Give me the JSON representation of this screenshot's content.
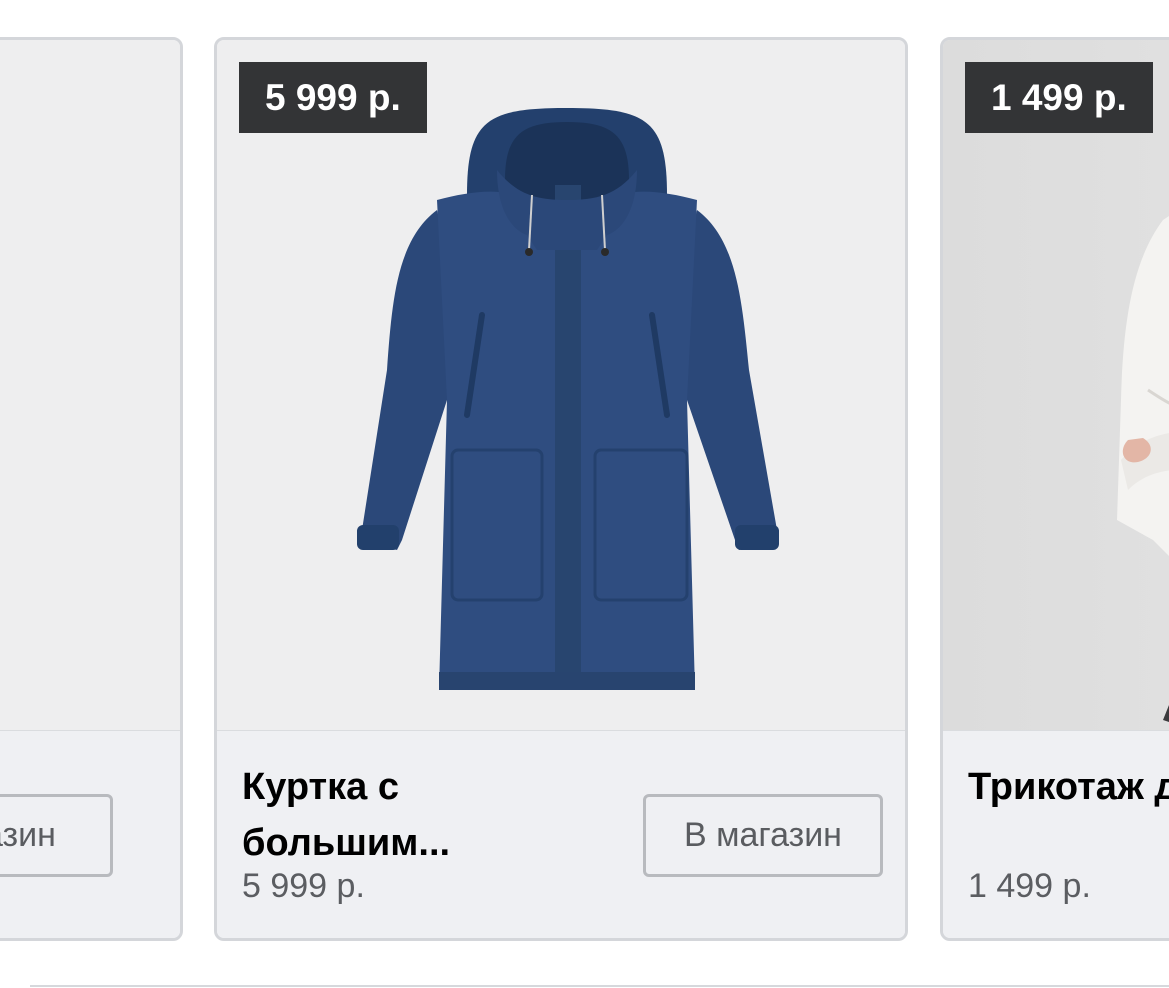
{
  "products": [
    {
      "title": "",
      "price_badge": "",
      "price": "",
      "button_label": "магазин"
    },
    {
      "title": "Куртка с большим...",
      "price_badge": "5 999 р.",
      "price": "5 999 р.",
      "button_label": "В магазин",
      "image": "navy-hooded-parka"
    },
    {
      "title": "Трикотаж джемпер",
      "price_badge": "1 499 р.",
      "price": "1 499 р.",
      "button_label": "",
      "image": "model-in-white-knit-sweater"
    }
  ],
  "colors": {
    "badge_bg": "#333436",
    "card_bg": "#eff0f3",
    "coat": "#2a4777"
  }
}
